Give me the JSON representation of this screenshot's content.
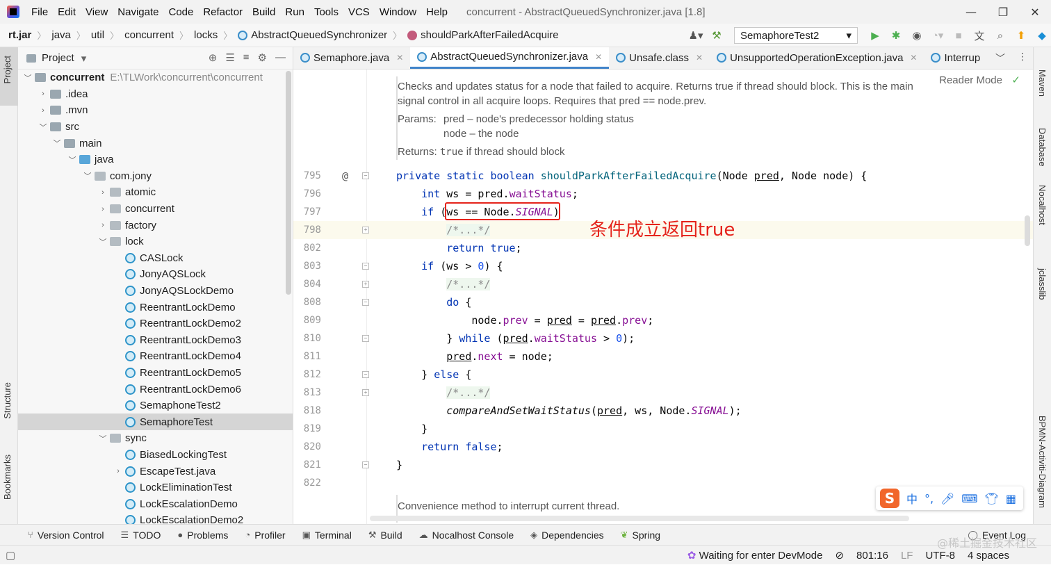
{
  "window": {
    "title": "concurrent - AbstractQueuedSynchronizer.java [1.8]",
    "menu": [
      "File",
      "Edit",
      "View",
      "Navigate",
      "Code",
      "Refactor",
      "Build",
      "Run",
      "Tools",
      "VCS",
      "Window",
      "Help"
    ],
    "controls": {
      "minimize": "—",
      "maximize": "❐",
      "close": "✕"
    }
  },
  "breadcrumb": [
    "rt.jar",
    "java",
    "util",
    "concurrent",
    "locks",
    "AbstractQueuedSynchronizer",
    "shouldParkAfterFailedAcquire"
  ],
  "run_config": "SemaphoreTest2",
  "project_panel": {
    "title": "Project",
    "root": {
      "name": "concurrent",
      "path": "E:\\TLWork\\concurrent\\concurrent"
    },
    "items": [
      ".idea",
      ".mvn",
      "src",
      "main",
      "java",
      "com.jony",
      "atomic",
      "concurrent",
      "factory",
      "lock",
      "CASLock",
      "JonyAQSLock",
      "JonyAQSLockDemo",
      "ReentrantLockDemo",
      "ReentrantLockDemo2",
      "ReentrantLockDemo3",
      "ReentrantLockDemo4",
      "ReentrantLockDemo5",
      "ReentrantLockDemo6",
      "SemaphoneTest2",
      "SemaphoreTest",
      "sync",
      "BiasedLockingTest",
      "EscapeTest.java",
      "LockEliminationTest",
      "LockEscalationDemo",
      "LockEscalationDemo2"
    ]
  },
  "tabs": [
    "Semaphore.java",
    "AbstractQueuedSynchronizer.java",
    "Unsafe.class",
    "UnsupportedOperationException.java",
    "Interrup"
  ],
  "reader_mode": "Reader Mode",
  "doc": {
    "description": "Checks and updates status for a node that failed to acquire. Returns true if thread should block. This is the main signal control in all acquire loops. Requires that pred == node.prev.",
    "params_label": "Params:",
    "param1": "pred – node's predecessor holding status",
    "param2": "node – the node",
    "returns_label": "Returns:",
    "returns_code": "true",
    "returns_text": " if thread should block",
    "next_doc": "Convenience method to interrupt current thread."
  },
  "line_numbers": [
    "795",
    "796",
    "797",
    "798",
    "802",
    "803",
    "804",
    "808",
    "809",
    "810",
    "811",
    "812",
    "813",
    "818",
    "819",
    "820",
    "821",
    "822"
  ],
  "annotation": "条件成立返回true",
  "bottom_tools": [
    "Version Control",
    "TODO",
    "Problems",
    "Profiler",
    "Terminal",
    "Build",
    "Nocalhost Console",
    "Dependencies",
    "Spring",
    "Event Log"
  ],
  "status": {
    "message": "Waiting for enter DevMode",
    "position": "801:16",
    "line_sep": "LF",
    "encoding": "UTF-8",
    "indent": "4 spaces"
  },
  "left_strip": [
    "Project",
    "Structure",
    "Bookmarks"
  ],
  "right_strip": [
    "Maven",
    "Database",
    "Nocalhost",
    "jclasslib",
    "BPMN-Activiti-Diagram"
  ],
  "ime_label": "中",
  "watermark": "@稀土掘金技术社区"
}
